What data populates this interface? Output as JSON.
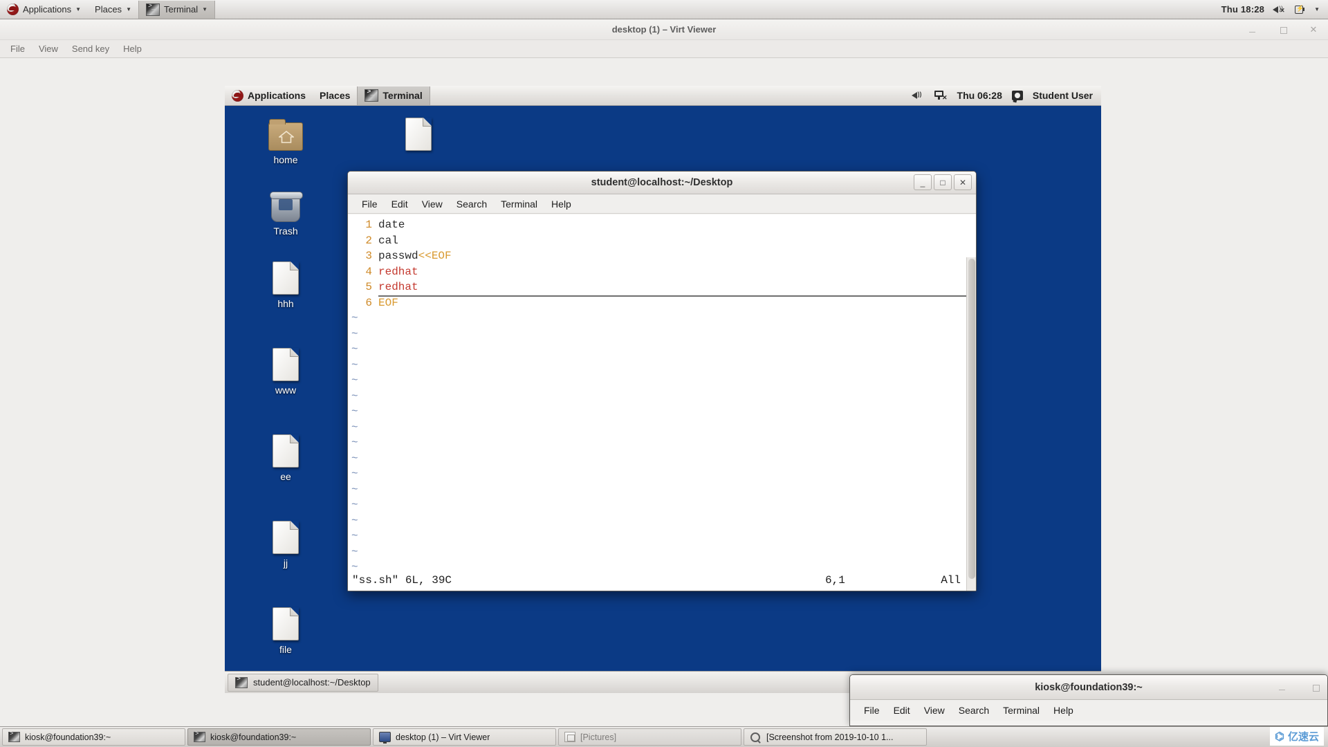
{
  "host_panel": {
    "logo": "redhat-logo",
    "menus": [
      {
        "label": "Applications",
        "caret": "▼"
      },
      {
        "label": "Places",
        "caret": "▼"
      },
      {
        "label": "Terminal",
        "caret": "▼"
      }
    ],
    "clock": "Thu 18:28",
    "icons": [
      "volume-muted-icon",
      "battery-charging-icon",
      "chevron-down-icon"
    ]
  },
  "virt_viewer": {
    "title": "desktop (1) – Virt Viewer",
    "window_controls": {
      "minimize": "_",
      "maximize": "□",
      "close": "✕"
    },
    "menus": [
      "File",
      "View",
      "Send key",
      "Help"
    ]
  },
  "guest_panel": {
    "menus": [
      {
        "label": "Applications"
      },
      {
        "label": "Places"
      },
      {
        "label": "Terminal"
      }
    ],
    "clock": "Thu 06:28",
    "user": "Student User",
    "icons": [
      "volume-icon",
      "network-disconnected-icon",
      "user-icon"
    ]
  },
  "desktop_icons": [
    {
      "label": "home",
      "type": "folder"
    },
    {
      "label": "Trash",
      "type": "trash"
    },
    {
      "label": "hhh",
      "type": "document"
    },
    {
      "label": "www",
      "type": "document"
    },
    {
      "label": "ee",
      "type": "document"
    },
    {
      "label": "jj",
      "type": "document"
    },
    {
      "label": "file",
      "type": "document"
    }
  ],
  "stray_desktop_icon": {
    "label": "",
    "type": "document"
  },
  "vim_window": {
    "title": "student@localhost:~/Desktop",
    "window_controls": {
      "minimize": "_",
      "maximize": "□",
      "close": "✕"
    },
    "menus": [
      "File",
      "Edit",
      "View",
      "Search",
      "Terminal",
      "Help"
    ],
    "lines": [
      {
        "num": "1",
        "tokens": [
          {
            "t": "date",
            "c": "plain"
          }
        ]
      },
      {
        "num": "2",
        "tokens": [
          {
            "t": "cal",
            "c": "plain"
          }
        ]
      },
      {
        "num": "3",
        "tokens": [
          {
            "t": "passwd",
            "c": "plain"
          },
          {
            "t": "<<EOF",
            "c": "kw"
          }
        ]
      },
      {
        "num": "4",
        "tokens": [
          {
            "t": "redhat",
            "c": "str"
          }
        ]
      },
      {
        "num": "5",
        "tokens": [
          {
            "t": "redhat",
            "c": "str"
          }
        ]
      },
      {
        "num": "6",
        "tokens": [
          {
            "t": "EOF",
            "c": "eof"
          }
        ]
      }
    ],
    "tilde_count": 18,
    "tilde_char": "~",
    "status": {
      "file": "\"ss.sh\" 6L, 39C",
      "position": "6,1",
      "scroll": "All"
    }
  },
  "guest_taskbar": {
    "items": [
      {
        "label": "student@localhost:~/Desktop",
        "icon": "terminal-icon"
      }
    ]
  },
  "kiosk_window": {
    "title": "kiosk@foundation39:~",
    "window_controls": {
      "minimize": "_",
      "maximize": "□"
    },
    "menus": [
      "File",
      "Edit",
      "View",
      "Search",
      "Terminal",
      "Help"
    ]
  },
  "host_taskbar": {
    "items": [
      {
        "label": "kiosk@foundation39:~",
        "icon": "terminal-icon",
        "state": "normal"
      },
      {
        "label": "kiosk@foundation39:~",
        "icon": "terminal-icon",
        "state": "pressed"
      },
      {
        "label": "desktop (1) – Virt Viewer",
        "icon": "monitor-icon",
        "state": "normal"
      },
      {
        "label": "[Pictures]",
        "icon": "image-icon",
        "state": "dim"
      },
      {
        "label": "[Screenshot from 2019-10-10 1...",
        "icon": "magnifier-icon",
        "state": "normal"
      }
    ]
  },
  "watermark": {
    "mark": "⌬",
    "text": "亿速云"
  }
}
